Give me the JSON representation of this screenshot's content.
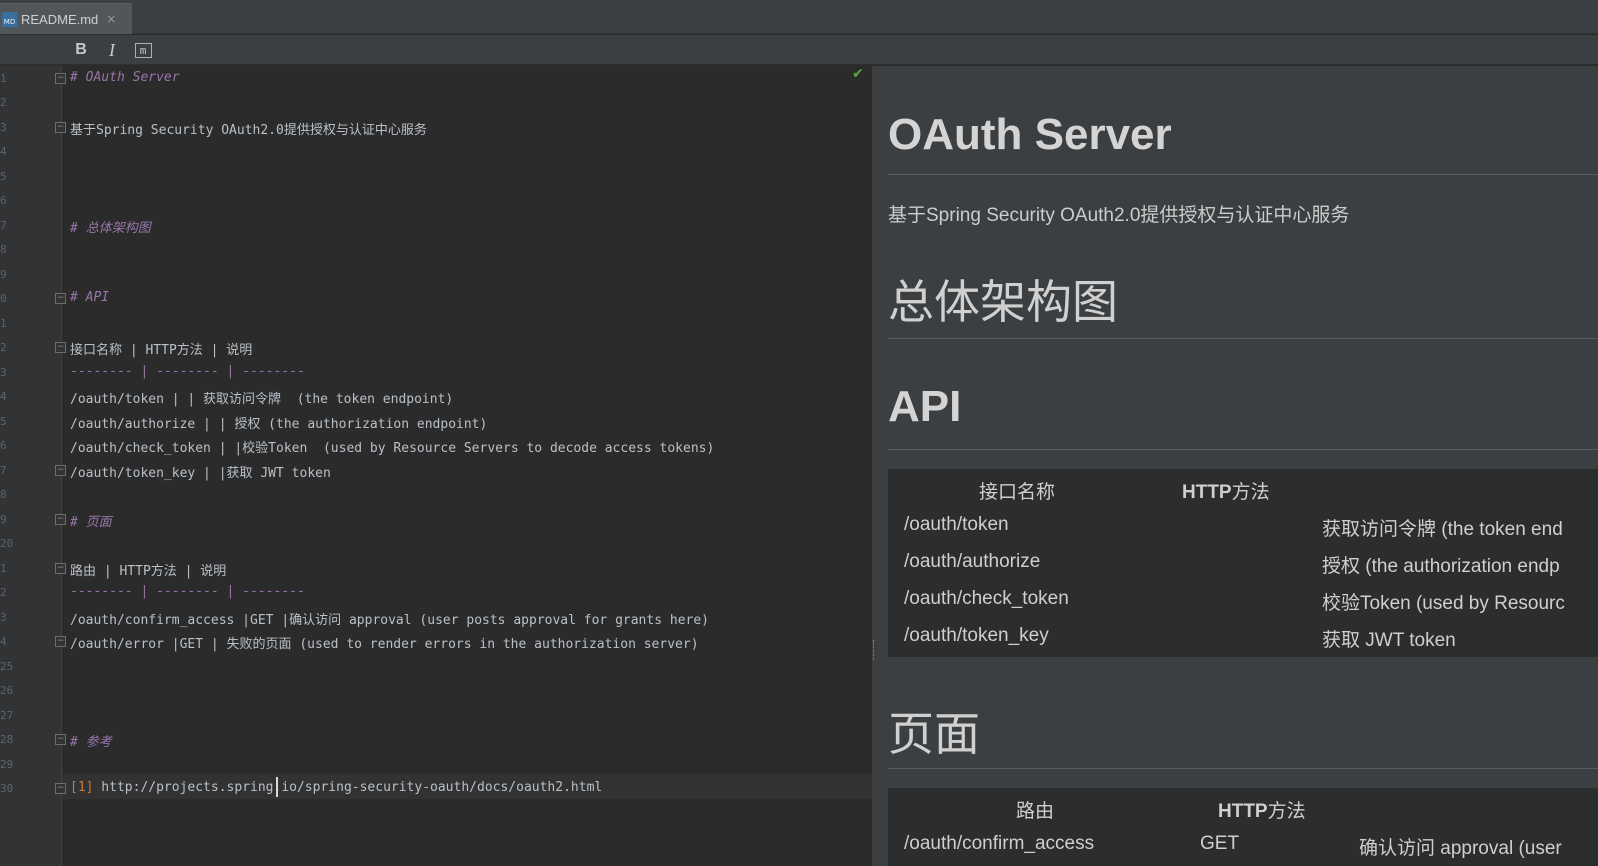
{
  "tab": {
    "icon_text": "MD",
    "label": "README.md",
    "close": "×"
  },
  "toolbar": {
    "bold": "B",
    "italic": "I",
    "mono": "m"
  },
  "editor": {
    "line_numbers": [
      "1",
      "2",
      "3",
      "4",
      "5",
      "6",
      "7",
      "8",
      "9",
      "0",
      "1",
      "2",
      "3",
      "4",
      "5",
      "6",
      "7",
      "8",
      "9",
      "20",
      "1",
      "2",
      "3",
      "4",
      "25",
      "26",
      "27",
      "28",
      "29",
      "30"
    ],
    "lines": {
      "l1": "# OAuth Server",
      "l3": "基于Spring Security OAuth2.0提供授权与认证中心服务",
      "l7": "# 总体架构图",
      "l10": "# API",
      "l12": "接口名称 | HTTP方法 | 说明",
      "l13": "-------- | -------- | --------",
      "l14": "/oauth/token | | 获取访问令牌  (the token endpoint)",
      "l15": "/oauth/authorize | | 授权 (the authorization endpoint)",
      "l16": "/oauth/check_token | |校验Token  (used by Resource Servers to decode access tokens)",
      "l17": "/oauth/token_key | |获取 JWT token",
      "l19": "# 页面",
      "l21": "路由 | HTTP方法 | 说明",
      "l22": "-------- | -------- | --------",
      "l23": "/oauth/confirm_access |GET |确认访问 approval (user posts approval for grants here)",
      "l24": "/oauth/error |GET | 失败的页面 (used to render errors in the authorization server)",
      "l28": "# 参考",
      "l30_ref": "[1]",
      "l30_url": " http://projects.spring.io/spring-security-oauth/docs/oauth2.html"
    }
  },
  "preview": {
    "h1": "OAuth Server",
    "intro": "基于Spring Security OAuth2.0提供授权与认证中心服务",
    "h_arch": "总体架构图",
    "h_api": "API",
    "api_table": {
      "headers": [
        "接口名称",
        "HTTP",
        "方法"
      ],
      "rows": [
        [
          "/oauth/token",
          "获取访问令牌 (the token end"
        ],
        [
          "/oauth/authorize",
          "授权 (the authorization endp"
        ],
        [
          "/oauth/check_token",
          "校验Token (used by Resourc"
        ],
        [
          "/oauth/token_key",
          "获取 JWT token"
        ]
      ]
    },
    "h_pages": "页面",
    "pages_table": {
      "headers": [
        "路由",
        "HTTP",
        "方法"
      ],
      "rows": [
        [
          "/oauth/confirm_access",
          "GET",
          "确认访问 approval (user"
        ]
      ]
    }
  }
}
